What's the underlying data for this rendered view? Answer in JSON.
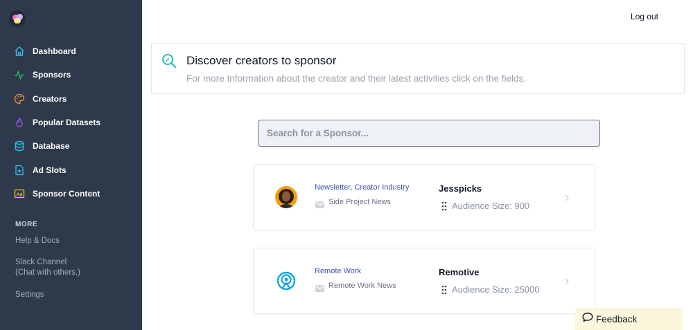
{
  "sidebar": {
    "logo_icon": "app-logo",
    "items": [
      {
        "label": "Dashboard",
        "icon": "home-icon",
        "color": "#38bdf8"
      },
      {
        "label": "Sponsors",
        "icon": "pulse-icon",
        "color": "#22c55e"
      },
      {
        "label": "Creators",
        "icon": "palette-icon",
        "color": "#fb923c"
      },
      {
        "label": "Popular Datasets",
        "icon": "fire-icon",
        "color": "#a855f7"
      },
      {
        "label": "Database",
        "icon": "database-icon",
        "color": "#38bdf8"
      },
      {
        "label": "Ad Slots",
        "icon": "document-plus-icon",
        "color": "#38bdf8"
      },
      {
        "label": "Sponsor Content",
        "icon": "ad-icon",
        "color": "#facc15"
      }
    ],
    "more_title": "MORE",
    "links": [
      "Help & Docs",
      "Slack Channel",
      "(Chat with others.)",
      "Settings"
    ]
  },
  "header": {
    "logout_label": "Log out"
  },
  "discover": {
    "title": "Discover creators to sponsor",
    "subtitle": "For more Information about the creator and their latest activities click on the fields.",
    "icon": "search-icon"
  },
  "search": {
    "placeholder": "Search for a Sponsor..."
  },
  "cards": [
    {
      "category": "Newsletter, Creator Industry",
      "source": "Side Project News",
      "name": "Jesspicks",
      "audience": "Audience Size: 900"
    },
    {
      "category": "Remote Work",
      "source": "Remote Work News",
      "name": "Remotive",
      "audience": "Audience Size: 25000"
    }
  ],
  "feedback": {
    "label": "Feedback"
  },
  "colors": {
    "sidebar_bg": "#2e3a4b",
    "accent_blue": "#3b4fb8",
    "feedback_bg": "#fbf7dc"
  }
}
